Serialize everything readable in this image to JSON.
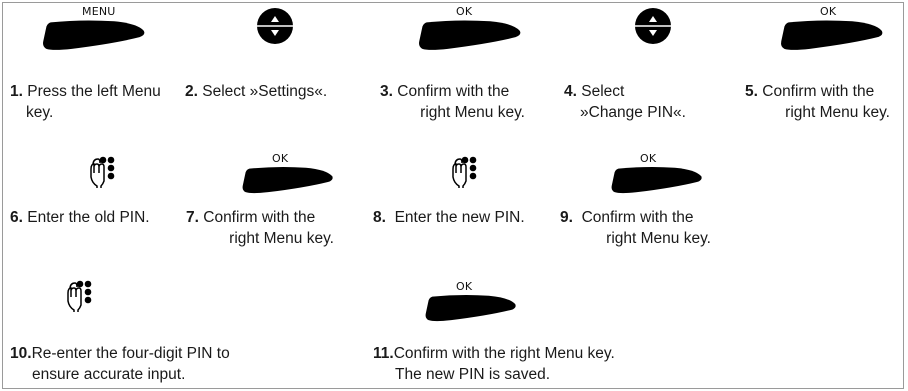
{
  "icon_names": {
    "softkey": "softkey-icon",
    "nav": "navigation-key-icon",
    "keypad": "keypad-hand-icon"
  },
  "key_labels": {
    "menu": "MENU",
    "ok": "OK"
  },
  "steps": [
    {
      "num": "1.",
      "line1": "Press the left Menu",
      "line2": "key."
    },
    {
      "num": "2.",
      "line1": "Select »Settings«.",
      "line2": ""
    },
    {
      "num": "3.",
      "line1": "Confirm with the",
      "line2": "right Menu key."
    },
    {
      "num": "4.",
      "line1": "Select",
      "line2": "»Change PIN«."
    },
    {
      "num": "5.",
      "line1": "Confirm with the",
      "line2": "right Menu key."
    },
    {
      "num": "6.",
      "line1": "Enter the old PIN.",
      "line2": ""
    },
    {
      "num": "7.",
      "line1": "Confirm with the",
      "line2": "right Menu key."
    },
    {
      "num": "8.",
      "line1": "Enter the new PIN.",
      "line2": ""
    },
    {
      "num": "9.",
      "line1": "Confirm with the",
      "line2": "right Menu key."
    },
    {
      "num": "10.",
      "line1": "Re-enter the four-digit PIN to",
      "line2": "ensure accurate input."
    },
    {
      "num": "11.",
      "line1": "Confirm with the right Menu key.",
      "line2": "The new PIN is saved."
    }
  ]
}
